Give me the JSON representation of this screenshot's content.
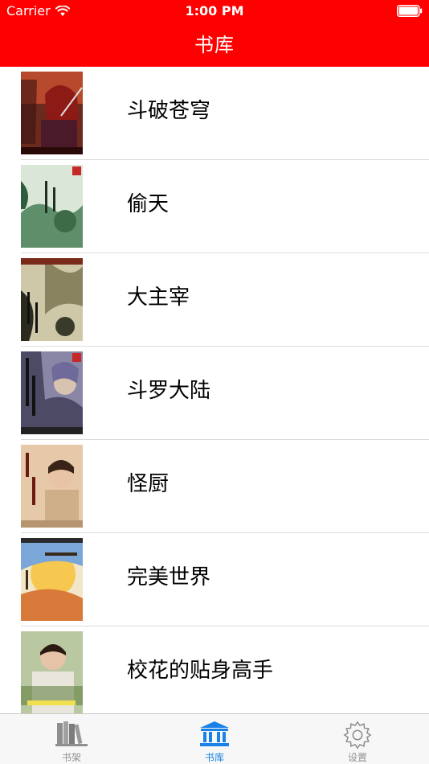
{
  "status_bar": {
    "carrier": "Carrier",
    "time": "1:00 PM",
    "wifi_icon": "wifi-icon",
    "battery_icon": "battery-icon"
  },
  "nav": {
    "title": "书库",
    "background_color": "#ff0000"
  },
  "books": [
    {
      "title": "斗破苍穹"
    },
    {
      "title": "偷天"
    },
    {
      "title": "大主宰"
    },
    {
      "title": "斗罗大陆"
    },
    {
      "title": "怪厨"
    },
    {
      "title": "完美世界"
    },
    {
      "title": "校花的贴身高手"
    }
  ],
  "tabs": [
    {
      "label": "书架",
      "icon": "bookshelf-icon",
      "active": false
    },
    {
      "label": "书库",
      "icon": "library-icon",
      "active": true
    },
    {
      "label": "设置",
      "icon": "gear-icon",
      "active": false
    }
  ],
  "colors": {
    "accent": "#ff0000",
    "tab_active": "#1a82e6",
    "tab_inactive": "#929292"
  }
}
